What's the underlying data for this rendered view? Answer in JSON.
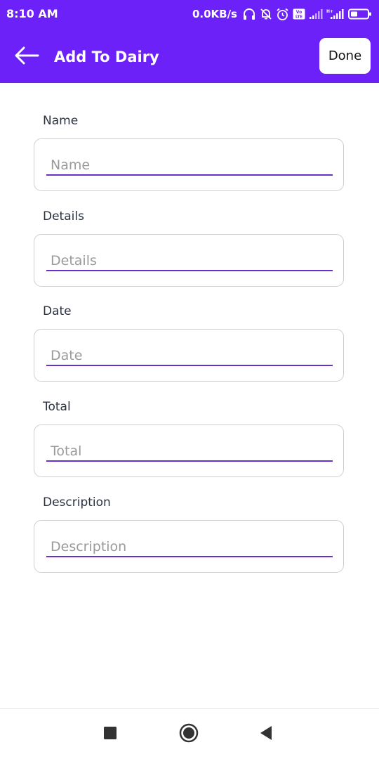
{
  "status_bar": {
    "time": "8:10 AM",
    "network_speed": "0.0KB/s",
    "icons": [
      "headphones-icon",
      "bell-off-icon",
      "alarm-icon",
      "volte-icon",
      "signal-icon",
      "signal-icon",
      "battery-icon"
    ],
    "volte_text": "Vo\nLTE",
    "secondary_signal_text": "H+"
  },
  "app_bar": {
    "back_icon": "arrow-left-icon",
    "title": "Add To Dairy",
    "done_label": "Done"
  },
  "form": {
    "fields": [
      {
        "label": "Name",
        "placeholder": "Name",
        "value": ""
      },
      {
        "label": "Details",
        "placeholder": "Details",
        "value": ""
      },
      {
        "label": "Date",
        "placeholder": "Date",
        "value": ""
      },
      {
        "label": "Total",
        "placeholder": "Total",
        "value": ""
      },
      {
        "label": "Description",
        "placeholder": "Description",
        "value": ""
      }
    ]
  },
  "nav_bar": {
    "icons": [
      "square-recents-icon",
      "circle-home-icon",
      "triangle-back-icon"
    ]
  },
  "colors": {
    "primary": "#6b21f7",
    "underline": "#6a2fc8",
    "field_border": "#cfcfcf",
    "label_text": "#2a3140",
    "placeholder_text": "#9a9a9a"
  }
}
